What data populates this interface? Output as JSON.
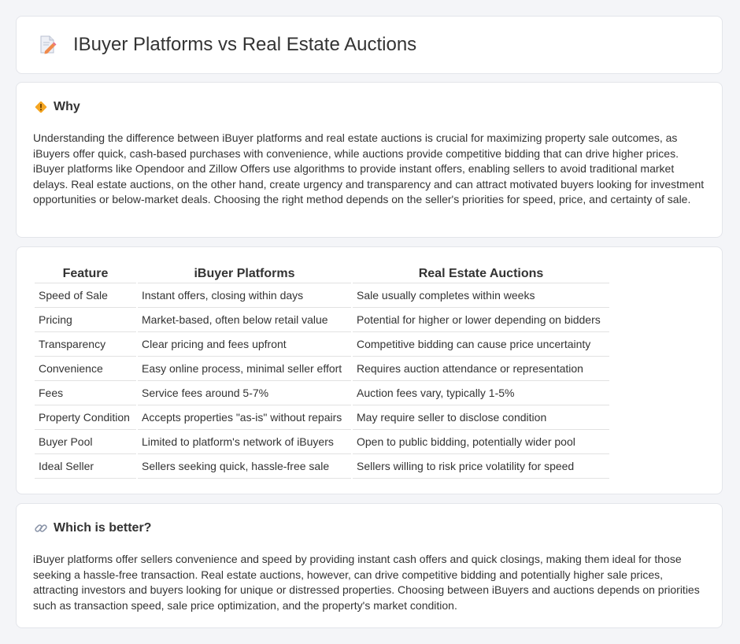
{
  "header": {
    "title": "IBuyer Platforms vs Real Estate Auctions",
    "icon": "document-pencil-icon"
  },
  "why": {
    "title": "Why",
    "icon": "diamond-warning-icon",
    "text": "Understanding the difference between iBuyer platforms and real estate auctions is crucial for maximizing property sale outcomes, as iBuyers offer quick, cash-based purchases with convenience, while auctions provide competitive bidding that can drive higher prices. iBuyer platforms like Opendoor and Zillow Offers use algorithms to provide instant offers, enabling sellers to avoid traditional market delays. Real estate auctions, on the other hand, create urgency and transparency and can attract motivated buyers looking for investment opportunities or below-market deals. Choosing the right method depends on the seller's priorities for speed, price, and certainty of sale."
  },
  "table": {
    "headers": [
      "Feature",
      "iBuyer Platforms",
      "Real Estate Auctions"
    ],
    "rows": [
      [
        "Speed of Sale",
        "Instant offers, closing within days",
        "Sale usually completes within weeks"
      ],
      [
        "Pricing",
        "Market-based, often below retail value",
        "Potential for higher or lower depending on bidders"
      ],
      [
        "Transparency",
        "Clear pricing and fees upfront",
        "Competitive bidding can cause price uncertainty"
      ],
      [
        "Convenience",
        "Easy online process, minimal seller effort",
        "Requires auction attendance or representation"
      ],
      [
        "Fees",
        "Service fees around 5-7%",
        "Auction fees vary, typically 1-5%"
      ],
      [
        "Property Condition",
        "Accepts properties \"as-is\" without repairs",
        "May require seller to disclose condition"
      ],
      [
        "Buyer Pool",
        "Limited to platform's network of iBuyers",
        "Open to public bidding, potentially wider pool"
      ],
      [
        "Ideal Seller",
        "Sellers seeking quick, hassle-free sale",
        "Sellers willing to risk price volatility for speed"
      ]
    ]
  },
  "better": {
    "title": "Which is better?",
    "icon": "link-icon",
    "text": "iBuyer platforms offer sellers convenience and speed by providing instant cash offers and quick closings, making them ideal for those seeking a hassle-free transaction. Real estate auctions, however, can drive competitive bidding and potentially higher sale prices, attracting investors and buyers looking for unique or distressed properties. Choosing between iBuyers and auctions depends on priorities such as transaction speed, sale price optimization, and the property's market condition."
  },
  "colors": {
    "background": "#f4f5f8",
    "card": "#ffffff",
    "text": "#333333",
    "icon_orange": "#f5a623",
    "icon_pink": "#e8708a"
  }
}
